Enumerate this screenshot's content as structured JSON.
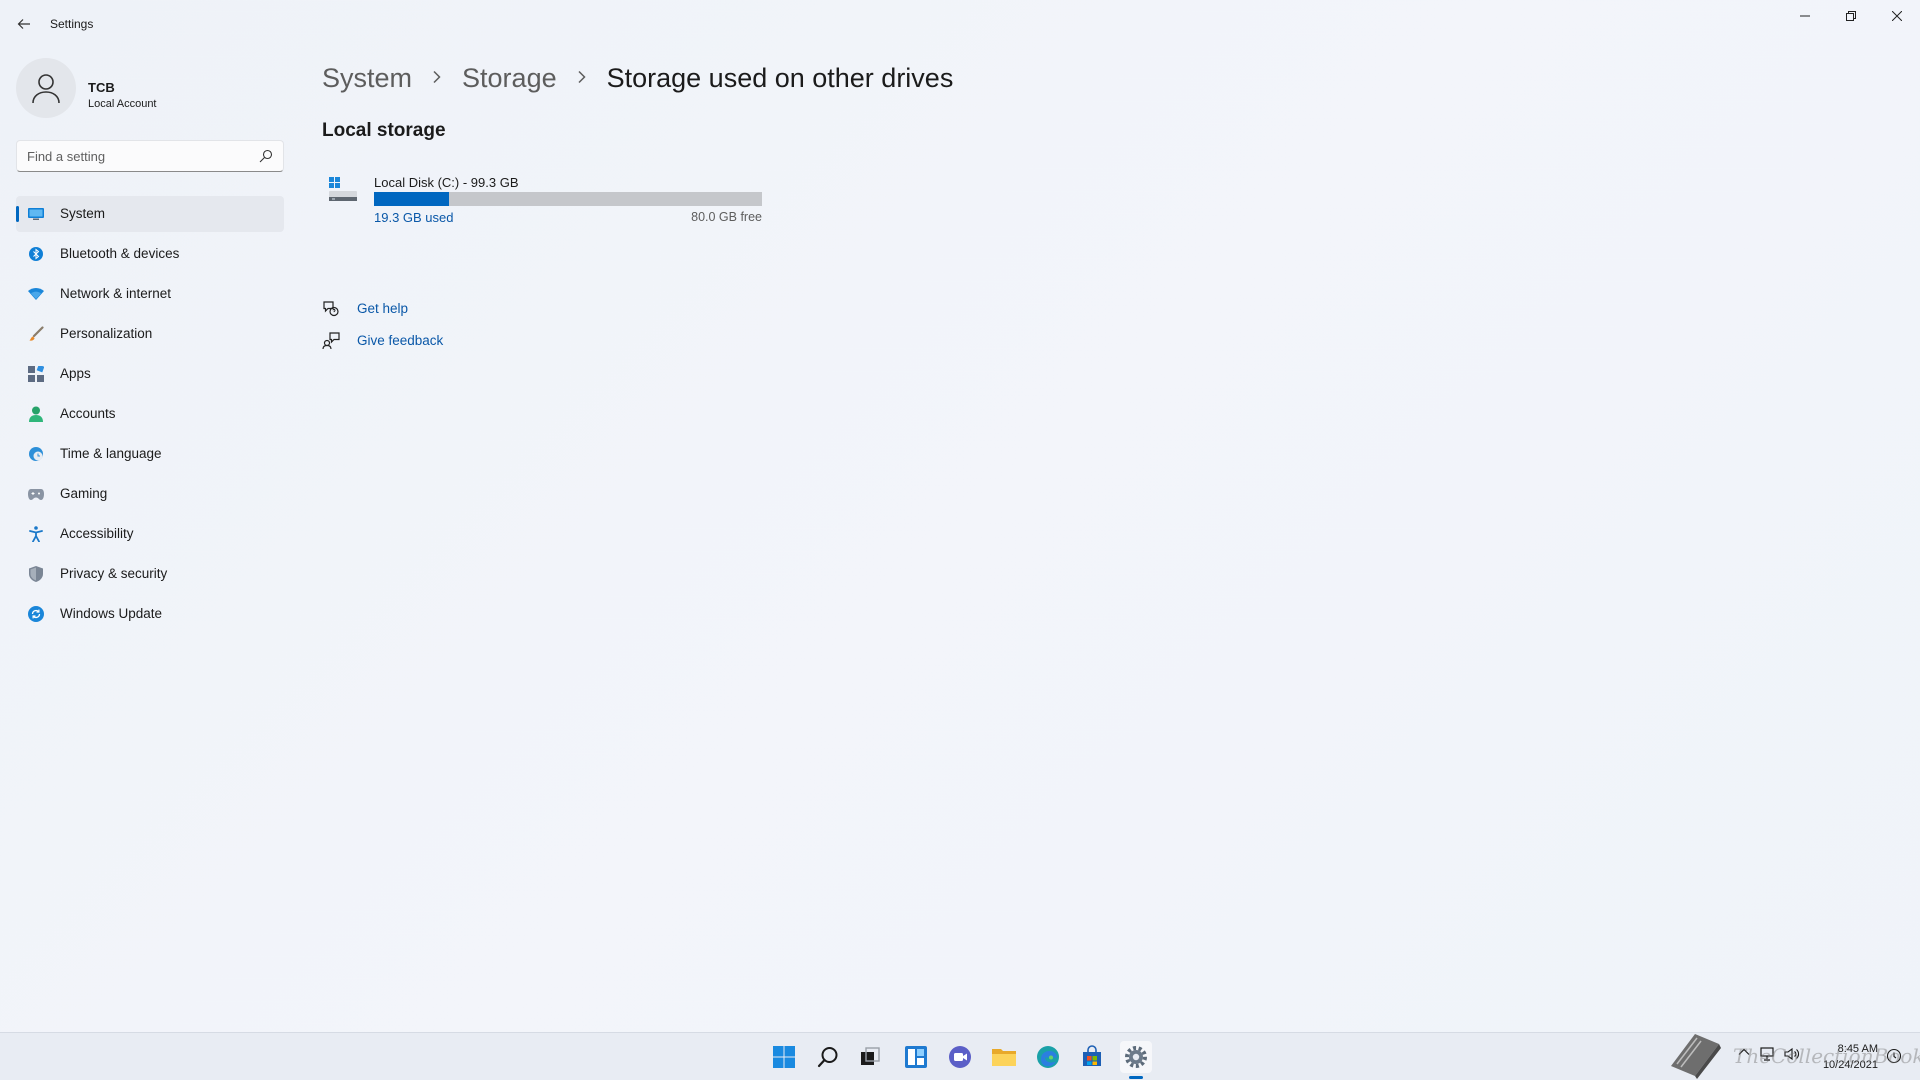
{
  "window": {
    "title": "Settings",
    "controls": [
      "minimize",
      "maximize",
      "close"
    ]
  },
  "profile": {
    "name": "TCB",
    "account_type": "Local Account"
  },
  "search": {
    "placeholder": "Find a setting"
  },
  "sidebar": {
    "items": [
      {
        "label": "System",
        "icon": "system-icon",
        "active": true
      },
      {
        "label": "Bluetooth & devices",
        "icon": "bluetooth-icon"
      },
      {
        "label": "Network & internet",
        "icon": "wifi-icon"
      },
      {
        "label": "Personalization",
        "icon": "brush-icon"
      },
      {
        "label": "Apps",
        "icon": "apps-icon"
      },
      {
        "label": "Accounts",
        "icon": "person-icon"
      },
      {
        "label": "Time & language",
        "icon": "globe-clock-icon"
      },
      {
        "label": "Gaming",
        "icon": "controller-icon"
      },
      {
        "label": "Accessibility",
        "icon": "accessibility-icon"
      },
      {
        "label": "Privacy & security",
        "icon": "shield-icon"
      },
      {
        "label": "Windows Update",
        "icon": "update-icon"
      }
    ]
  },
  "breadcrumb": {
    "items": [
      "System",
      "Storage",
      "Storage used on other drives"
    ]
  },
  "local_storage": {
    "title": "Local storage",
    "drive": {
      "name": "Local Disk (C:) - 99.3 GB",
      "used": "19.3 GB used",
      "free": "80.0 GB free",
      "used_fraction": 0.194
    }
  },
  "help_links": {
    "get_help": "Get help",
    "give_feedback": "Give feedback"
  },
  "taskbar": {
    "apps": [
      "start-icon",
      "search-icon",
      "task-view-icon",
      "widgets-icon",
      "chat-icon",
      "file-explorer-icon",
      "edge-icon",
      "store-icon",
      "settings-icon"
    ],
    "time": "8:45 AM",
    "date": "10/24/2021",
    "watermark": "TheCollectionBook"
  },
  "colors": {
    "accent": "#0067c0",
    "link": "#0a58a8"
  }
}
